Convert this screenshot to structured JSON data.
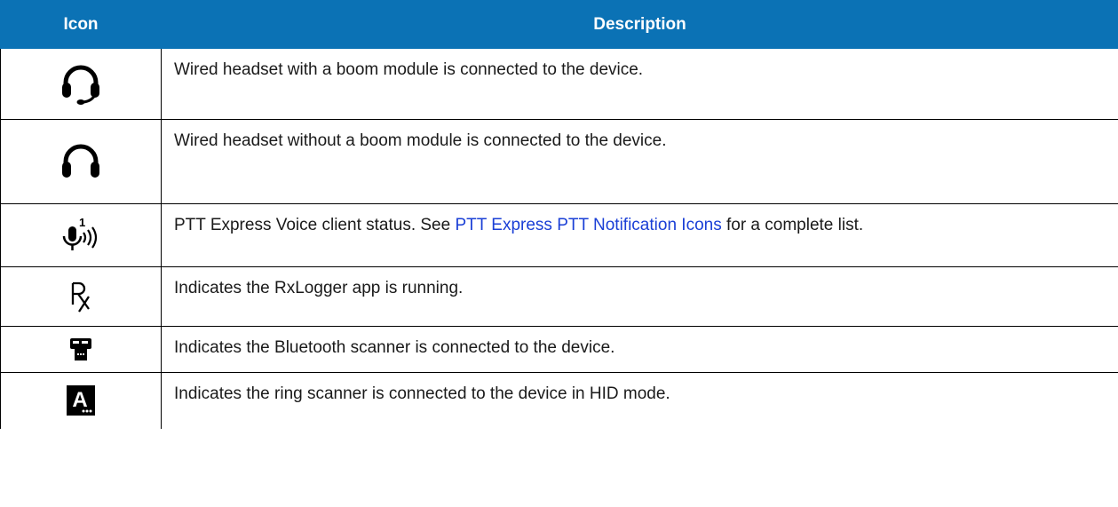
{
  "table": {
    "headers": {
      "icon": "Icon",
      "description": "Description"
    },
    "rows": [
      {
        "icon": "headset-boom-icon",
        "description": "Wired headset with a boom module is connected to the device."
      },
      {
        "icon": "headset-icon",
        "description": "Wired headset without a boom module is connected to the device."
      },
      {
        "icon": "ptt-voice-icon",
        "icon_superscript": "1",
        "description_prefix": "PTT Express Voice client status. See ",
        "description_link": "PTT Express PTT Notification Icons",
        "description_suffix": " for a complete list."
      },
      {
        "icon": "rx-icon",
        "description": "Indicates the RxLogger app is running."
      },
      {
        "icon": "bluetooth-scanner-icon",
        "description": "Indicates the Bluetooth scanner is connected to the device."
      },
      {
        "icon": "ring-scanner-hid-icon",
        "icon_letter": "A",
        "description": "Indicates the ring scanner is connected to the device in HID mode."
      }
    ]
  },
  "colors": {
    "header_bg": "#0b72b5",
    "header_text": "#ffffff",
    "link": "#1a3fd6",
    "border": "#000000"
  }
}
